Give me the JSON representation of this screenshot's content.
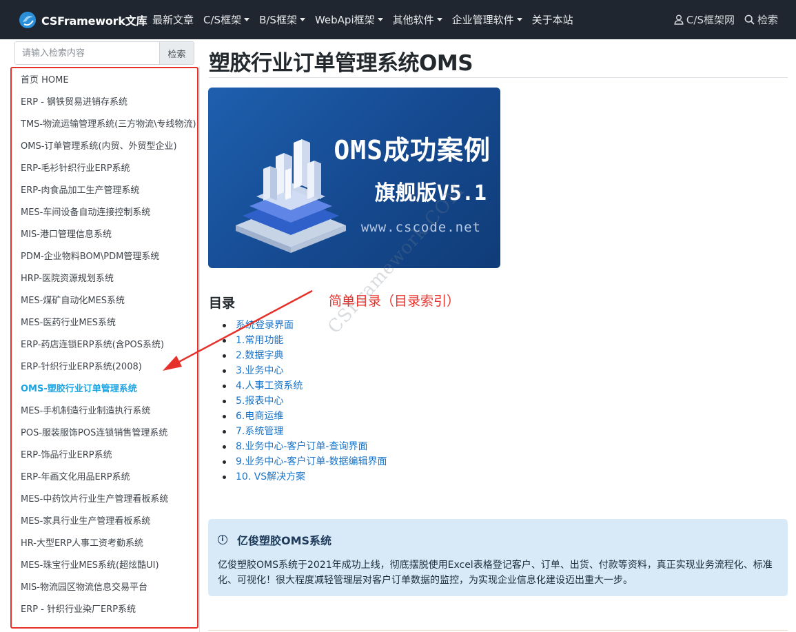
{
  "navbar": {
    "brand": "CSFramework文库",
    "items": [
      {
        "label": "最新文章",
        "dropdown": false
      },
      {
        "label": "C/S框架",
        "dropdown": true
      },
      {
        "label": "B/S框架",
        "dropdown": true
      },
      {
        "label": "WebApi框架",
        "dropdown": true
      },
      {
        "label": "其他软件",
        "dropdown": true
      },
      {
        "label": "企业管理软件",
        "dropdown": true
      },
      {
        "label": "关于本站",
        "dropdown": false
      }
    ],
    "right": {
      "user_label": "C/S框架网",
      "search_label": "检索"
    }
  },
  "sidebar": {
    "search": {
      "placeholder": "请输入检索内容",
      "button": "检索"
    },
    "items": [
      "首页 HOME",
      "ERP - 钢铁贸易进销存系统",
      "TMS-物流运输管理系统(三方物流\\专线物流)",
      "OMS-订单管理系统(内贸、外贸型企业)",
      "ERP-毛衫针织行业ERP系统",
      "ERP-肉食品加工生产管理系统",
      "MES-车间设备自动连接控制系统",
      "MIS-港口管理信息系统",
      "PDM-企业物料BOM\\PDM管理系统",
      "HRP-医院资源规划系统",
      "MES-煤矿自动化MES系统",
      "MES-医药行业MES系统",
      "ERP-药店连锁ERP系统(含POS系统)",
      "ERP-针织行业ERP系统(2008)",
      "OMS-塑胶行业订单管理系统",
      "MES-手机制造行业制造执行系统",
      "POS-服装服饰POS连锁销售管理系统",
      "ERP-饰品行业ERP系统",
      "ERP-年画文化用品ERP系统",
      "MES-中药饮片行业生产管理看板系统",
      "MES-家具行业生产管理看板系统",
      "HR-大型ERP人事工资考勤系统",
      "MES-珠宝行业MES系统(超炫酷UI)",
      "MIS-物流园区物流信息交易平台",
      "ERP - 针织行业染厂ERP系统"
    ],
    "active_index": 14
  },
  "main": {
    "title": "塑胶行业订单管理系统OMS",
    "banner": {
      "title": "OMS成功案例",
      "subtitle": "旗舰版V5.1",
      "url": "www.cscode.net"
    },
    "toc_heading": "目录",
    "annotation": "简单目录（目录索引）",
    "watermark": "CSFramework.COM",
    "toc": [
      "系统登录界面",
      "1.常用功能",
      "2.数据字典",
      "3.业务中心",
      "4.人事工资系统",
      "5.报表中心",
      "6.电商运维",
      "7.系统管理",
      "8.业务中心-客户订单-查询界面",
      "9.业务中心-客户订单-数据编辑界面",
      "10. VS解决方案"
    ],
    "info": {
      "heading": "亿俊塑胶OMS系统",
      "text": "亿俊塑胶OMS系统于2021年成功上线，彻底摆脱使用Excel表格登记客户、订单、出货、付款等资料，真正实现业务流程化、标准化、可视化！很大程度减轻管理层对客户订单数据的监控，为实现企业信息化建设迈出重大一步。"
    }
  },
  "colors": {
    "navbar_bg": "#1f2630",
    "active_link": "#1ba3e2",
    "toc_link": "#1a73c7",
    "annotation_red": "#e6312b",
    "info_bg": "#d8eaf8"
  }
}
